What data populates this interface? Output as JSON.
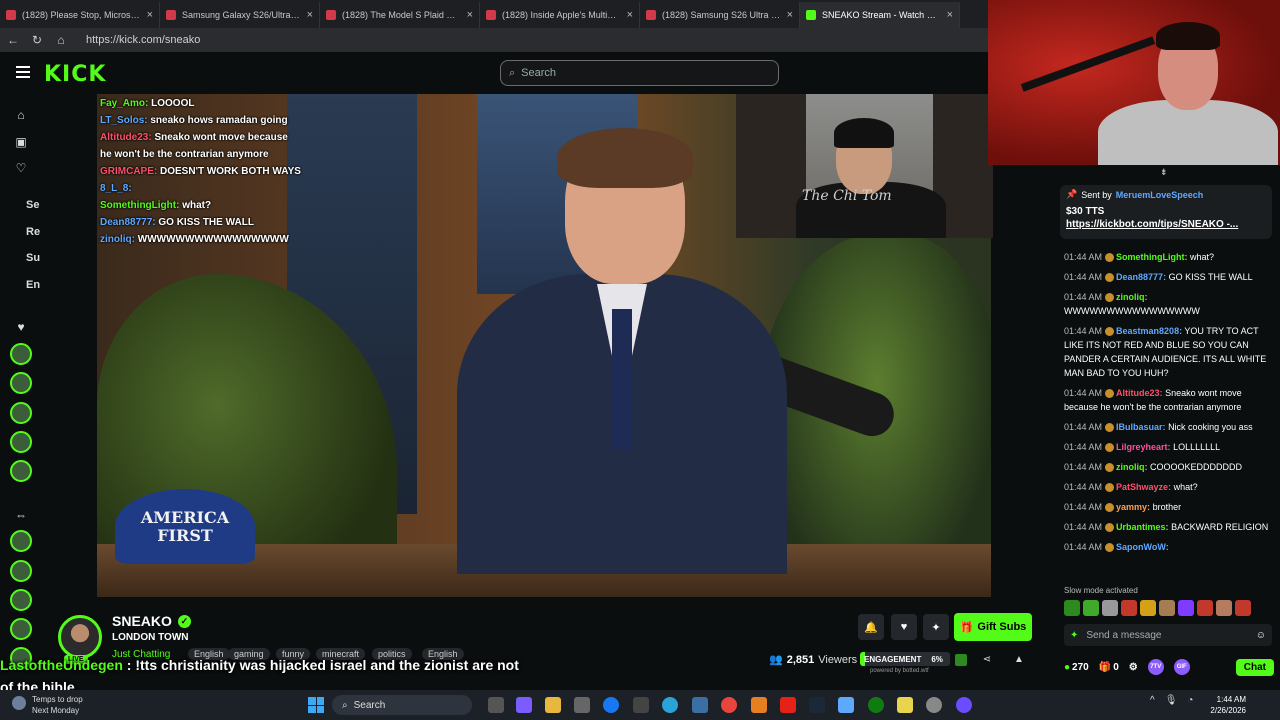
{
  "browser": {
    "tabs": [
      {
        "title": "(1828) Please Stop, Microsoft... - Y",
        "icon": "youtube-icon",
        "active": false
      },
      {
        "title": "Samsung Galaxy S26/Ultra Impres",
        "icon": "youtube-icon",
        "active": false
      },
      {
        "title": "(1828) The Model S Plaid Walked",
        "icon": "youtube-icon",
        "active": false
      },
      {
        "title": "(1828) Inside Apple's Multibillion-",
        "icon": "youtube-icon",
        "active": false
      },
      {
        "title": "(1828) Samsung S26 Ultra Hands",
        "icon": "youtube-icon",
        "active": false
      },
      {
        "title": "SNEAKO Stream - Watch Live",
        "icon": "kick-icon",
        "active": true
      }
    ],
    "url": "https://kick.com/sneako"
  },
  "header": {
    "logo": "KICK",
    "search_placeholder": "Search"
  },
  "sidebar": {
    "sections": [
      "Se",
      "Re",
      "Su",
      "En"
    ]
  },
  "overlay_chat": [
    {
      "user": "Fay_Amo:",
      "msg": "LOOOOL",
      "color": "#53fc18"
    },
    {
      "user": "LT_Solos:",
      "msg": "sneako hows ramadan going",
      "color": "#5fa8ff"
    },
    {
      "user": "Altitude23:",
      "msg": "Sneako wont move because",
      "color": "#ff4f6d"
    },
    {
      "user": "",
      "msg": "he won't be the contrarian anymore",
      "color": "#ffffff"
    },
    {
      "user": "GRIMCAPE:",
      "msg": "DOESN'T WORK BOTH WAYS",
      "color": "#ff4f6d"
    },
    {
      "user": "8_L_8:",
      "msg": "",
      "color": "#5fa8ff"
    },
    {
      "user": "SomethingLight:",
      "msg": "what?",
      "color": "#53fc18"
    },
    {
      "user": "Dean88777:",
      "msg": "GO KISS THE WALL",
      "color": "#5fa8ff"
    },
    {
      "user": "zinoliq:",
      "msg": "WWWWWWWWWWWWWWWW",
      "color": "#5fa8ff"
    }
  ],
  "video": {
    "hat_line1": "AMERICA",
    "hat_line2": "FIRST",
    "inset_script": "The Chi Tom"
  },
  "stream": {
    "channel": "SNEAKO",
    "title": "LONDON TOWN",
    "category": "Just Chatting",
    "live": "LIVE",
    "tags": [
      "English",
      "gaming",
      "funny",
      "minecraft",
      "politics",
      "English"
    ],
    "viewers": "2,851",
    "viewers_label": "Viewers",
    "engagement_label": "ENGAGEMENT",
    "engagement_pct": "6%",
    "engagement_fraction": 0.06,
    "powered": "powered by botted.wtf",
    "gift_subs": "Gift Subs"
  },
  "tts_overlay": {
    "user": "LastoftheUndegen",
    "msg": " : !tts christianity was hijacked israel and the zionist are not of the bible"
  },
  "chat": {
    "pinned": {
      "sent_by_label": "Sent by",
      "user": "MeruemLoveSpeech",
      "amount": "$30 TTS",
      "link": "https://kickbot.com/tips/SNEAKO -..."
    },
    "messages": [
      {
        "time": "01:44 AM",
        "user": "SomethingLight:",
        "msg": "what?",
        "color": "#53fc18"
      },
      {
        "time": "01:44 AM",
        "user": "Dean88777:",
        "msg": "GO KISS THE WALL",
        "color": "#5fa8ff"
      },
      {
        "time": "01:44 AM",
        "user": "zinoliq:",
        "msg": "WWWWWWWWWWWWWWWW",
        "color": "#53fc18"
      },
      {
        "time": "01:44 AM",
        "user": "Beastman8208:",
        "msg": "YOU TRY TO ACT LIKE ITS NOT RED AND BLUE SO YOU CAN PANDER A CERTAIN AUDIENCE. ITS ALL WHITE MAN BAD TO YOU HUH?",
        "color": "#5fa8ff"
      },
      {
        "time": "01:44 AM",
        "user": "Altitude23:",
        "msg": "Sneako wont move because he won't be the contrarian anymore",
        "color": "#ff4f6d"
      },
      {
        "time": "01:44 AM",
        "user": "IBulbasuar:",
        "msg": "Nick cooking you ass",
        "color": "#5fa8ff"
      },
      {
        "time": "01:44 AM",
        "user": "Lilgreyheart:",
        "msg": "LOLLLLLLL",
        "color": "#ff4f9d"
      },
      {
        "time": "01:44 AM",
        "user": "zinoliq:",
        "msg": "COOOOKEDDDDDDD",
        "color": "#53fc18"
      },
      {
        "time": "01:44 AM",
        "user": "PatShwayze:",
        "msg": "what?",
        "color": "#ff4f6d"
      },
      {
        "time": "01:44 AM",
        "user": "yammy:",
        "msg": "brother",
        "color": "#ff9f4f"
      },
      {
        "time": "01:44 AM",
        "user": "Urbantimes:",
        "msg": "BACKWARD RELIGION",
        "color": "#53fc18"
      },
      {
        "time": "01:44 AM",
        "user": "SaponWoW:",
        "msg": "",
        "color": "#5fa8ff"
      }
    ],
    "slow_mode": "Slow mode activated",
    "send_placeholder": "Send a message",
    "points": "270",
    "zero": "0",
    "chat_button": "Chat"
  },
  "taskbar": {
    "weather_temp": "Temps to drop",
    "weather_sub": "Next Monday",
    "search": "Search",
    "time": "1:44 AM",
    "date": "2/26/2026"
  }
}
